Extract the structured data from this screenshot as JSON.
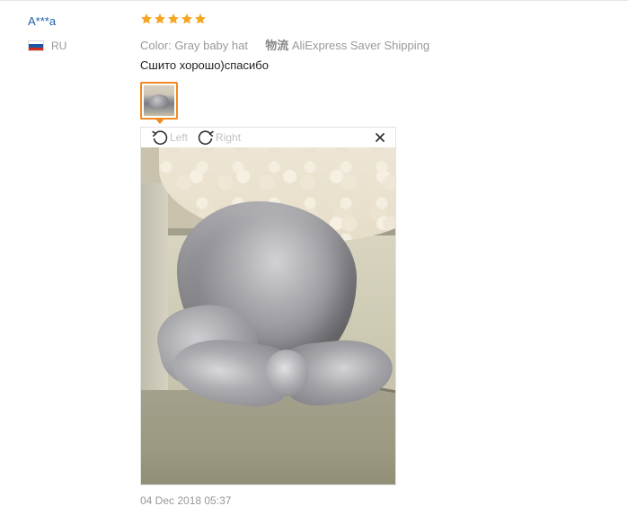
{
  "reviewer": {
    "name": "A***a",
    "country_code": "RU",
    "flag_colors": [
      "#ffffff",
      "#1c57a5",
      "#d52b1e"
    ]
  },
  "review": {
    "rating": 5,
    "star_color": "#f5a623",
    "color_label": "Color:",
    "color_value": "Gray baby hat",
    "logistics_label": "物流",
    "logistics_value": "AliExpress Saver Shipping",
    "text": "Сшито хорошо)спасибо",
    "date": "04 Dec 2018 05:37"
  },
  "viewer": {
    "rotate_left_label": "Left",
    "rotate_right_label": "Right",
    "rotate_left_icon": "rotate-left-icon",
    "rotate_right_icon": "rotate-right-icon",
    "close_icon": "close-icon"
  },
  "accent_color": "#f08a24"
}
